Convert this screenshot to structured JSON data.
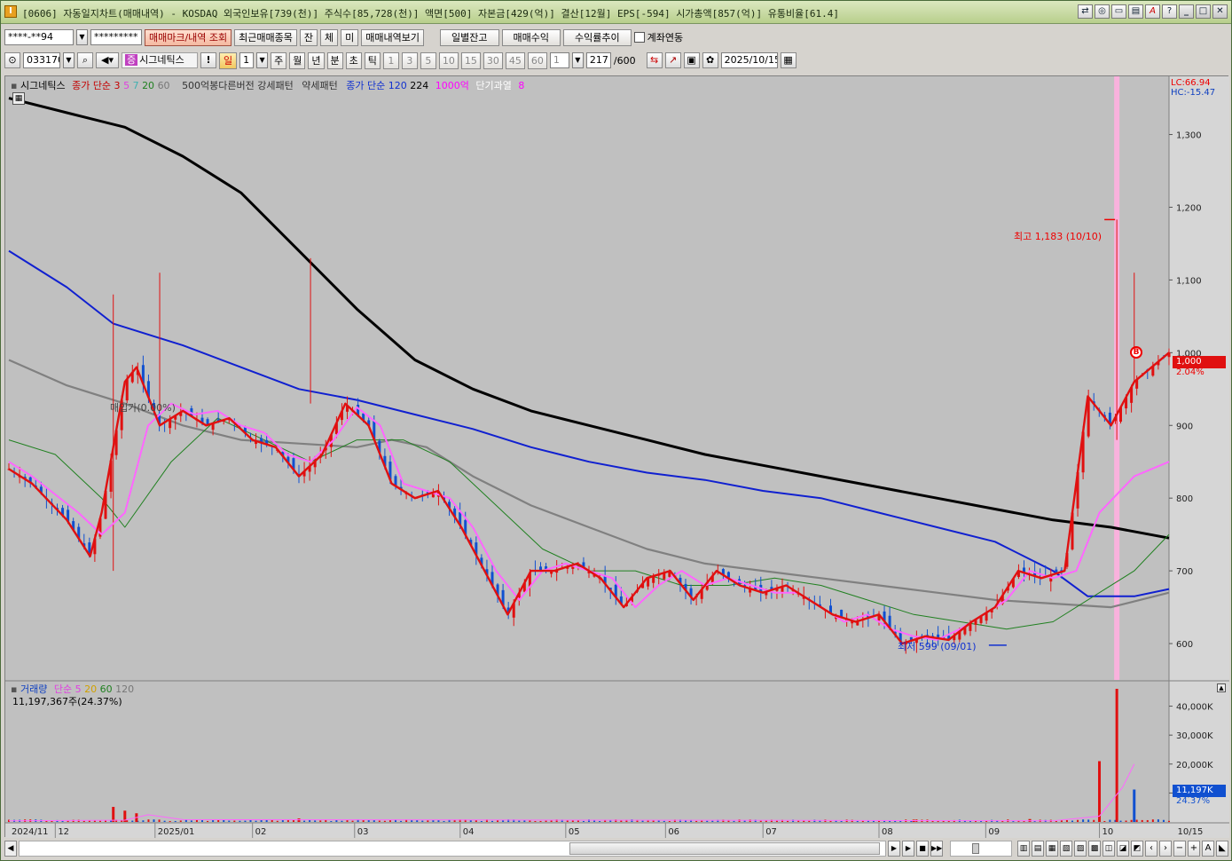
{
  "window": {
    "title": "[0606] 자동일지차트(매매내역) - KOSDAQ 외국인보유[739(천)] 주식수[85,728(천)] 액면[500] 자본금[429(억)] 결산[12월] EPS[-594] 시가총액[857(억)] 유통비율[61.4]",
    "app_icon": "I"
  },
  "toolbar1": {
    "account": "****-**94",
    "password": "*********",
    "btn_mark": "매매마크/내역 조회",
    "btn_recent": "최근매매종목",
    "btn_jan": "잔",
    "btn_che": "체",
    "btn_mi": "미",
    "btn_history": "매매내역보기",
    "btn_daily_balance": "일별잔고",
    "btn_profit": "매매수익",
    "btn_return": "수익률추이",
    "account_link": "계좌연동"
  },
  "toolbar2": {
    "code": "033170",
    "name": "시그네틱스",
    "period_day": "일",
    "period_num": "1",
    "periods": [
      "주",
      "월",
      "년",
      "분",
      "초",
      "틱"
    ],
    "intervals": [
      "1",
      "3",
      "5",
      "10",
      "15",
      "30",
      "45",
      "60"
    ],
    "interval_sel": "1",
    "count": "217",
    "count_max": "/600",
    "date": "2025/10/15"
  },
  "legend_price": {
    "stock": "시그네틱스",
    "close_ma": "종가 단순 3",
    "ma5": "5",
    "ma7": "7",
    "ma20": "20",
    "ma60": "60",
    "pattern": "500억봉다른버전 강세패턴",
    "weak": "약세패턴",
    "close_ma120": "종가 단순 120",
    "ma224": "224",
    "amt": "1000억",
    "overheat": "단기과열",
    "overheat_n": "8"
  },
  "price_right": {
    "lc": "LC:66.94",
    "hc": "HC:-15.47",
    "current": "1,000",
    "pct": "2.04%"
  },
  "annotations": {
    "high": "최고 1,183 (10/10)",
    "low": "최저 599 (09/01)",
    "trade_marker": "매입가(0.00%)",
    "b_marker": "B"
  },
  "legend_volume": {
    "label": "거래량",
    "ma5": "단순 5",
    "ma20": "20",
    "ma60": "60",
    "ma120": "120",
    "value": "11,197,367주(24.37%)",
    "current": "11,197K",
    "pct": "24.37%"
  },
  "colors": {
    "up": "#e01010",
    "down": "#1050d0",
    "ma3": "#e01010",
    "ma5": "#ff66ff",
    "ma20": "#208020",
    "ma60": "#808080",
    "ma120": "#1020d0",
    "ma224": "#000000",
    "highlight": "#ffb0e0"
  },
  "chart_data": {
    "type": "candlestick",
    "x_labels": [
      "2024/11",
      "12",
      "2025/01",
      "02",
      "03",
      "04",
      "05",
      "06",
      "07",
      "08",
      "09",
      "10",
      "10/15"
    ],
    "price_ticks": [
      "1,300",
      "1,200",
      "1,100",
      "1,000",
      "900",
      "800",
      "700",
      "600"
    ],
    "volume_ticks": [
      "40,000K",
      "30,000K",
      "20,000K",
      "10,000K"
    ],
    "price_range": [
      550,
      1380
    ],
    "volume_range": [
      0,
      46000
    ],
    "ma224_points": [
      [
        0,
        1350
      ],
      [
        0.05,
        1330
      ],
      [
        0.1,
        1310
      ],
      [
        0.15,
        1270
      ],
      [
        0.2,
        1220
      ],
      [
        0.25,
        1140
      ],
      [
        0.3,
        1060
      ],
      [
        0.35,
        990
      ],
      [
        0.4,
        950
      ],
      [
        0.45,
        920
      ],
      [
        0.5,
        900
      ],
      [
        0.55,
        880
      ],
      [
        0.6,
        860
      ],
      [
        0.65,
        845
      ],
      [
        0.7,
        830
      ],
      [
        0.75,
        815
      ],
      [
        0.8,
        800
      ],
      [
        0.85,
        785
      ],
      [
        0.9,
        770
      ],
      [
        0.95,
        760
      ],
      [
        1,
        745
      ]
    ],
    "ma120_points": [
      [
        0,
        1140
      ],
      [
        0.05,
        1090
      ],
      [
        0.09,
        1040
      ],
      [
        0.15,
        1010
      ],
      [
        0.2,
        980
      ],
      [
        0.25,
        950
      ],
      [
        0.3,
        935
      ],
      [
        0.35,
        915
      ],
      [
        0.4,
        895
      ],
      [
        0.45,
        870
      ],
      [
        0.5,
        850
      ],
      [
        0.55,
        835
      ],
      [
        0.6,
        825
      ],
      [
        0.65,
        810
      ],
      [
        0.7,
        800
      ],
      [
        0.75,
        780
      ],
      [
        0.8,
        760
      ],
      [
        0.85,
        740
      ],
      [
        0.9,
        700
      ],
      [
        0.93,
        665
      ],
      [
        0.97,
        665
      ],
      [
        1,
        675
      ]
    ],
    "ma60_points": [
      [
        0,
        990
      ],
      [
        0.05,
        955
      ],
      [
        0.1,
        930
      ],
      [
        0.15,
        900
      ],
      [
        0.2,
        880
      ],
      [
        0.25,
        875
      ],
      [
        0.3,
        870
      ],
      [
        0.33,
        880
      ],
      [
        0.36,
        870
      ],
      [
        0.4,
        830
      ],
      [
        0.45,
        790
      ],
      [
        0.5,
        760
      ],
      [
        0.55,
        730
      ],
      [
        0.6,
        710
      ],
      [
        0.65,
        700
      ],
      [
        0.7,
        690
      ],
      [
        0.75,
        680
      ],
      [
        0.8,
        670
      ],
      [
        0.85,
        660
      ],
      [
        0.9,
        655
      ],
      [
        0.95,
        650
      ],
      [
        1,
        670
      ]
    ],
    "ma20_points": [
      [
        0,
        880
      ],
      [
        0.04,
        860
      ],
      [
        0.08,
        800
      ],
      [
        0.1,
        760
      ],
      [
        0.14,
        850
      ],
      [
        0.18,
        910
      ],
      [
        0.22,
        880
      ],
      [
        0.26,
        850
      ],
      [
        0.3,
        880
      ],
      [
        0.34,
        880
      ],
      [
        0.38,
        850
      ],
      [
        0.42,
        790
      ],
      [
        0.46,
        730
      ],
      [
        0.5,
        700
      ],
      [
        0.54,
        700
      ],
      [
        0.58,
        680
      ],
      [
        0.62,
        680
      ],
      [
        0.66,
        690
      ],
      [
        0.7,
        680
      ],
      [
        0.74,
        660
      ],
      [
        0.78,
        640
      ],
      [
        0.82,
        630
      ],
      [
        0.86,
        620
      ],
      [
        0.9,
        630
      ],
      [
        0.94,
        670
      ],
      [
        0.97,
        700
      ],
      [
        1,
        750
      ]
    ],
    "ma5_points": [
      [
        0,
        850
      ],
      [
        0.02,
        830
      ],
      [
        0.06,
        780
      ],
      [
        0.08,
        750
      ],
      [
        0.1,
        780
      ],
      [
        0.12,
        900
      ],
      [
        0.14,
        930
      ],
      [
        0.16,
        915
      ],
      [
        0.18,
        920
      ],
      [
        0.2,
        900
      ],
      [
        0.22,
        890
      ],
      [
        0.24,
        860
      ],
      [
        0.26,
        850
      ],
      [
        0.28,
        880
      ],
      [
        0.3,
        925
      ],
      [
        0.32,
        900
      ],
      [
        0.34,
        820
      ],
      [
        0.36,
        810
      ],
      [
        0.38,
        800
      ],
      [
        0.4,
        760
      ],
      [
        0.42,
        700
      ],
      [
        0.44,
        660
      ],
      [
        0.46,
        700
      ],
      [
        0.48,
        710
      ],
      [
        0.5,
        700
      ],
      [
        0.52,
        690
      ],
      [
        0.54,
        650
      ],
      [
        0.56,
        680
      ],
      [
        0.58,
        700
      ],
      [
        0.6,
        680
      ],
      [
        0.62,
        690
      ],
      [
        0.64,
        680
      ],
      [
        0.66,
        670
      ],
      [
        0.68,
        670
      ],
      [
        0.7,
        650
      ],
      [
        0.72,
        630
      ],
      [
        0.74,
        640
      ],
      [
        0.76,
        620
      ],
      [
        0.78,
        610
      ],
      [
        0.8,
        605
      ],
      [
        0.82,
        620
      ],
      [
        0.84,
        640
      ],
      [
        0.86,
        660
      ],
      [
        0.88,
        700
      ],
      [
        0.9,
        690
      ],
      [
        0.92,
        700
      ],
      [
        0.94,
        780
      ],
      [
        0.97,
        830
      ],
      [
        1,
        850
      ]
    ],
    "ma3_points": [
      [
        0,
        840
      ],
      [
        0.02,
        820
      ],
      [
        0.05,
        770
      ],
      [
        0.07,
        720
      ],
      [
        0.08,
        780
      ],
      [
        0.1,
        960
      ],
      [
        0.11,
        980
      ],
      [
        0.13,
        900
      ],
      [
        0.15,
        920
      ],
      [
        0.17,
        900
      ],
      [
        0.19,
        910
      ],
      [
        0.21,
        880
      ],
      [
        0.23,
        870
      ],
      [
        0.25,
        830
      ],
      [
        0.27,
        860
      ],
      [
        0.29,
        930
      ],
      [
        0.31,
        900
      ],
      [
        0.33,
        820
      ],
      [
        0.35,
        800
      ],
      [
        0.37,
        810
      ],
      [
        0.39,
        760
      ],
      [
        0.41,
        700
      ],
      [
        0.43,
        640
      ],
      [
        0.45,
        700
      ],
      [
        0.47,
        700
      ],
      [
        0.49,
        710
      ],
      [
        0.51,
        690
      ],
      [
        0.53,
        650
      ],
      [
        0.55,
        690
      ],
      [
        0.57,
        700
      ],
      [
        0.59,
        660
      ],
      [
        0.61,
        700
      ],
      [
        0.63,
        680
      ],
      [
        0.65,
        670
      ],
      [
        0.67,
        680
      ],
      [
        0.69,
        660
      ],
      [
        0.71,
        640
      ],
      [
        0.73,
        630
      ],
      [
        0.75,
        640
      ],
      [
        0.77,
        600
      ],
      [
        0.79,
        610
      ],
      [
        0.81,
        605
      ],
      [
        0.83,
        630
      ],
      [
        0.85,
        650
      ],
      [
        0.87,
        700
      ],
      [
        0.89,
        690
      ],
      [
        0.91,
        700
      ],
      [
        0.93,
        940
      ],
      [
        0.95,
        900
      ],
      [
        0.97,
        960
      ],
      [
        1,
        1000
      ]
    ],
    "volume_spikes": [
      [
        0.09,
        5200
      ],
      [
        0.1,
        3900
      ],
      [
        0.11,
        3000
      ],
      [
        0.25,
        1200
      ],
      [
        0.78,
        800
      ],
      [
        0.88,
        1000
      ],
      [
        0.94,
        21000
      ],
      [
        0.955,
        46000
      ],
      [
        0.97,
        11197
      ]
    ]
  }
}
